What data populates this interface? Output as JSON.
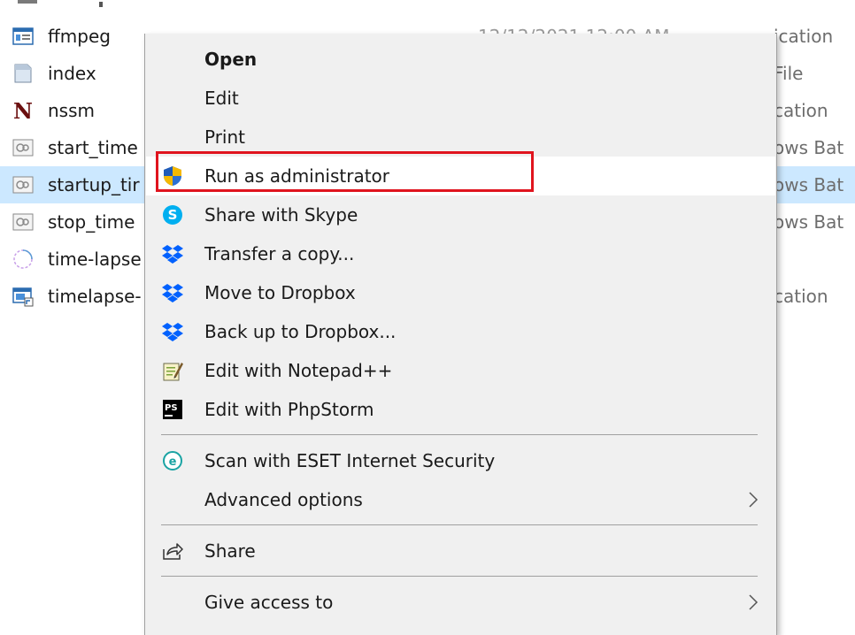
{
  "files": [
    {
      "name": "ffmpeg",
      "type": "Application",
      "date": "12/12/2021 12:00 AM",
      "icon": "application-icon"
    },
    {
      "name": "index",
      "type": "File",
      "date": "",
      "icon": "file-icon"
    },
    {
      "name": "nssm",
      "type": "Application",
      "date": "",
      "icon": "nssm-icon"
    },
    {
      "name": "start_time",
      "type": "Windows Batch File",
      "date": "",
      "icon": "batch-file-icon"
    },
    {
      "name": "startup_tir",
      "type": "Windows Batch File",
      "date": "",
      "icon": "batch-file-icon"
    },
    {
      "name": "stop_time",
      "type": "Windows Batch File",
      "date": "",
      "icon": "batch-file-icon"
    },
    {
      "name": "time-lapse",
      "type": "",
      "date": "",
      "icon": "loading-file-icon"
    },
    {
      "name": "timelapse-",
      "type": "Application",
      "date": "",
      "icon": "application-icon"
    }
  ],
  "file_type_visible": [
    "ication",
    "File",
    "cation",
    "ows Bat",
    "ows Bat",
    "ows Bat",
    "",
    "cation"
  ],
  "context_menu": {
    "items": [
      {
        "label": "Open",
        "bold": true,
        "icon": ""
      },
      {
        "label": "Edit",
        "icon": ""
      },
      {
        "label": "Print",
        "icon": ""
      },
      {
        "label": "Run as administrator",
        "icon": "uac-shield-icon",
        "highlighted": true
      },
      {
        "label": "Share with Skype",
        "icon": "skype-icon"
      },
      {
        "label": "Transfer a copy...",
        "icon": "dropbox-icon"
      },
      {
        "label": "Move to Dropbox",
        "icon": "dropbox-icon"
      },
      {
        "label": "Back up to Dropbox...",
        "icon": "dropbox-icon"
      },
      {
        "label": "Edit with Notepad++",
        "icon": "notepadplusplus-icon"
      },
      {
        "label": "Edit with PhpStorm",
        "icon": "phpstorm-icon"
      },
      {
        "label": "Scan with ESET Internet Security",
        "icon": "eset-icon"
      },
      {
        "label": "Advanced options",
        "icon": "",
        "submenu": true
      },
      {
        "label": "Share",
        "icon": "share-icon"
      },
      {
        "label": "Give access to",
        "icon": "",
        "submenu": true
      }
    ]
  },
  "colors": {
    "highlight_border": "#e0141e",
    "selected_row": "#cce8ff",
    "menu_background": "#f0f0f0",
    "dropbox_blue": "#0061fe",
    "skype_blue": "#00aff0"
  }
}
